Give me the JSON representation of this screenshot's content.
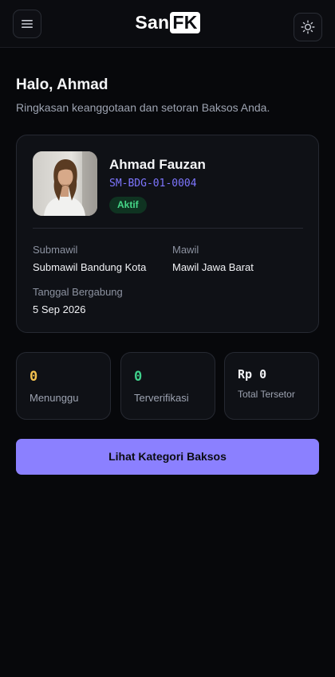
{
  "header": {
    "logo_text": "San",
    "logo_box": "FK",
    "menu_icon": "hamburger-icon",
    "theme_icon": "sun-icon"
  },
  "greeting": {
    "title": "Halo, Ahmad",
    "subtitle": "Ringkasan keanggotaan dan setoran Baksos Anda."
  },
  "profile": {
    "name": "Ahmad Fauzan",
    "member_code": "SM-BDG-01-0004",
    "status": "Aktif",
    "submawil_label": "Submawil",
    "submawil_value": "Submawil Bandung Kota",
    "mawil_label": "Mawil",
    "mawil_value": "Mawil Jawa Barat",
    "joined_label": "Tanggal Bergabung",
    "joined_value": "5 Sep 2026"
  },
  "stats": [
    {
      "value": "0",
      "label": "Menunggu",
      "color": "#f2c14e"
    },
    {
      "value": "0",
      "label": "Terverifikasi",
      "color": "#3fd08b"
    },
    {
      "value": "Rp 0",
      "label": "Total Tersetor",
      "color": "#f2f3f6"
    }
  ],
  "actions": {
    "view_categories": "Lihat Kategori Baksos"
  }
}
